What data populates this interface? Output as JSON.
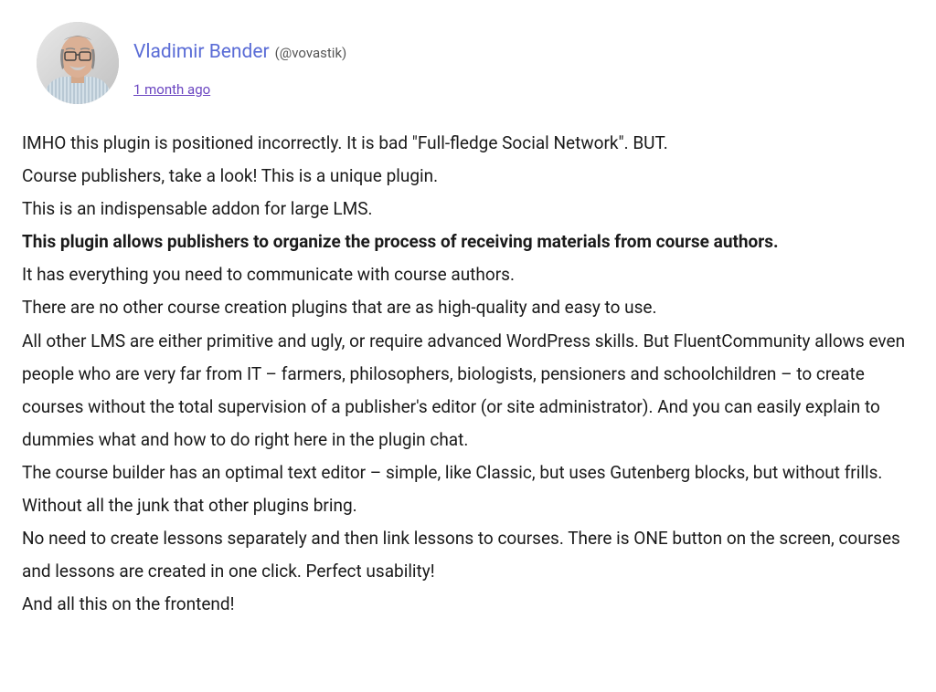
{
  "comment": {
    "author": {
      "name": "Vladimir Bender",
      "handle": "(@vovastik)"
    },
    "timestamp": "1 month ago",
    "body": {
      "p1": "IMHO this plugin is positioned incorrectly. It is bad \"Full-fledge Social Network\". BUT.",
      "p2": "Course publishers, take a look! This is a unique plugin.",
      "p3": "This is an indispensable addon for large LMS.",
      "p4": "This plugin allows publishers to organize the process of receiving materials from course authors.",
      "p5": "It has everything you need to communicate with course authors.",
      "p6": "There are no other course creation plugins that are as high-quality and easy to use.",
      "p7": "All other LMS are either primitive and ugly, or require advanced WordPress skills. But FluentCommunity allows even people who are very far from IT – farmers, philosophers, biologists, pensioners and schoolchildren – to create courses without the total supervision of a publisher's editor (or site administrator). And you can easily explain to dummies what and how to do right here in the plugin chat.",
      "p8": "The course builder has an optimal text editor – simple, like Classic, but uses Gutenberg blocks, but without frills. Without all the junk that other plugins bring.",
      "p9": "No need to create lessons separately and then link lessons to courses. There is ONE button on the screen, courses and lessons are created in one click. Perfect usability!",
      "p10": "And all this on the frontend!"
    }
  }
}
